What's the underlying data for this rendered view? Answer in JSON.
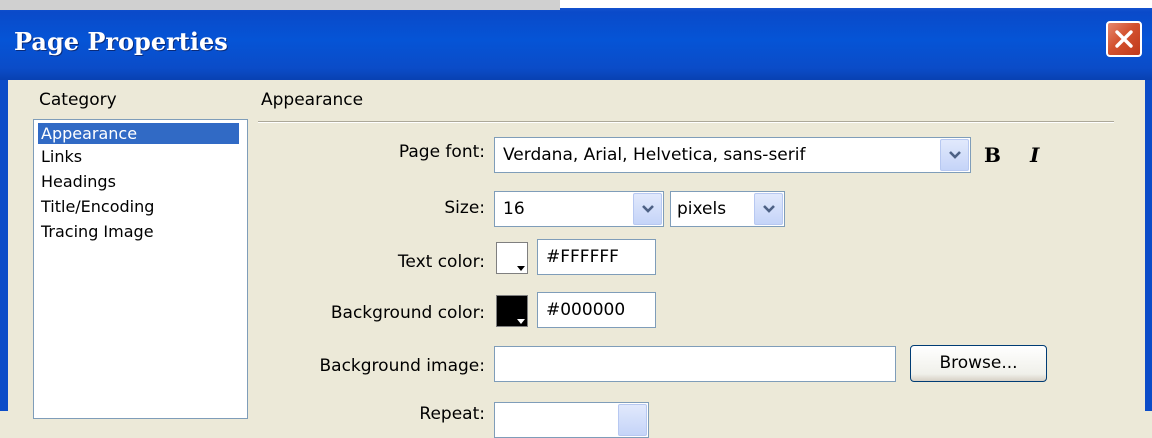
{
  "window": {
    "title": "Page Properties"
  },
  "category": {
    "label": "Category",
    "items": [
      {
        "label": "Appearance",
        "selected": true
      },
      {
        "label": "Links",
        "selected": false
      },
      {
        "label": "Headings",
        "selected": false
      },
      {
        "label": "Title/Encoding",
        "selected": false
      },
      {
        "label": "Tracing Image",
        "selected": false
      }
    ]
  },
  "appearance": {
    "section_title": "Appearance",
    "page_font": {
      "label": "Page font:",
      "value": "Verdana, Arial, Helvetica, sans-serif",
      "bold_label": "B",
      "italic_label": "I"
    },
    "size": {
      "label": "Size:",
      "value": "16",
      "unit": "pixels"
    },
    "text_color": {
      "label": "Text color:",
      "value": "#FFFFFF",
      "swatch": "#FFFFFF"
    },
    "background_color": {
      "label": "Background color:",
      "value": "#000000",
      "swatch": "#000000"
    },
    "background_image": {
      "label": "Background image:",
      "value": "",
      "browse_label": "Browse..."
    },
    "repeat": {
      "label": "Repeat:",
      "value": ""
    }
  },
  "colors": {
    "title_bar": "#0554d6",
    "selection": "#316ac5",
    "dialog_bg": "#ece9d8",
    "close_button": "#d3522f"
  }
}
